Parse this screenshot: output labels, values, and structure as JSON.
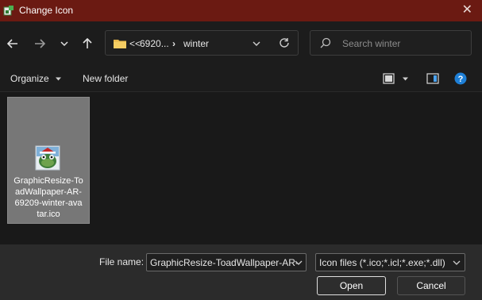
{
  "window": {
    "title": "Change Icon"
  },
  "nav": {
    "breadcrumb": [
      "<<",
      "6920...",
      "winter"
    ],
    "search_placeholder": "Search winter"
  },
  "toolbar": {
    "organize": "Organize",
    "new_folder": "New folder"
  },
  "files": [
    {
      "name": "GraphicResize-ToadWallpaper-AR-69209-winter-avatar.ico",
      "display_lines": [
        "GraphicResize-To",
        "adWallpaper-AR-",
        "69209-winter-ava",
        "tar.ico"
      ],
      "selected": true
    }
  ],
  "footer": {
    "file_name_label": "File name:",
    "file_name_value": "GraphicResize-ToadWallpaper-AR-",
    "filter_value": "Icon files (*.ico;*.icl;*.exe;*.dll)",
    "open_label": "Open",
    "cancel_label": "Cancel"
  },
  "colors": {
    "titlebar": "#6b1a12",
    "selection": "#777777",
    "help": "#1e7fd6"
  }
}
